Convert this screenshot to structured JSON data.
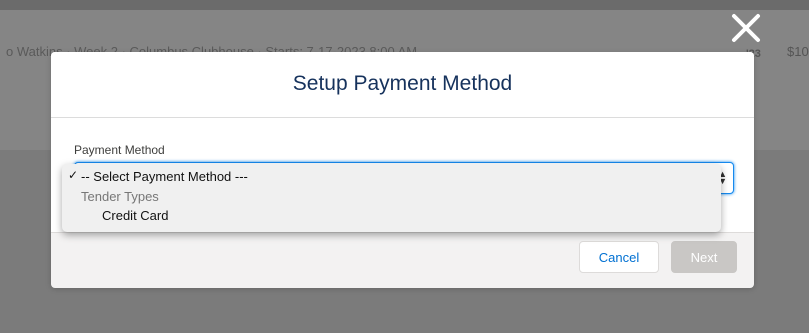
{
  "background": {
    "row_text_left": "o Watkins · Week 2 · Columbus Clubhouse · Starts: 7-17-2023 8:00 AM",
    "row_text_right_1": "'23",
    "row_text_right_2": "$10"
  },
  "close_icon": "close-icon",
  "modal": {
    "title": "Setup Payment Method",
    "field_label": "Payment Method",
    "select_value": "-- Select Payment Method ---",
    "cancel_label": "Cancel",
    "next_label": "Next"
  },
  "dropdown": {
    "check_mark": "✓",
    "selected_label": "-- Select Payment Method ---",
    "group_label": "Tender Types",
    "options": [
      "Credit Card"
    ]
  },
  "colors": {
    "overlay": "#7b7b7b",
    "title": "#16325c",
    "focus": "#1589ee",
    "link": "#0070d2",
    "disabled_button": "#c9c7c5"
  }
}
